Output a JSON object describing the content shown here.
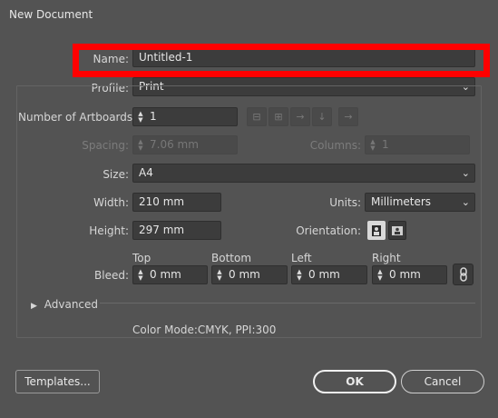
{
  "window": {
    "title": "New Document"
  },
  "name": {
    "label": "Name:",
    "value": "Untitled-1"
  },
  "profile": {
    "label": "Profile:",
    "value": "Print"
  },
  "artboards": {
    "label": "Number of Artboards:",
    "value": "1"
  },
  "spacing": {
    "label": "Spacing:",
    "value": "7.06 mm"
  },
  "columns": {
    "label": "Columns:",
    "value": "1"
  },
  "size": {
    "label": "Size:",
    "value": "A4"
  },
  "width": {
    "label": "Width:",
    "value": "210 mm"
  },
  "units": {
    "label": "Units:",
    "value": "Millimeters"
  },
  "height": {
    "label": "Height:",
    "value": "297 mm"
  },
  "orientation": {
    "label": "Orientation:",
    "selected": "portrait"
  },
  "bleed": {
    "label": "Bleed:",
    "top": {
      "label": "Top",
      "value": "0 mm"
    },
    "bottom": {
      "label": "Bottom",
      "value": "0 mm"
    },
    "left": {
      "label": "Left",
      "value": "0 mm"
    },
    "right": {
      "label": "Right",
      "value": "0 mm"
    }
  },
  "advanced": {
    "label": "Advanced"
  },
  "color_mode_text": "Color Mode:CMYK, PPI:300",
  "buttons": {
    "templates": "Templates...",
    "ok": "OK",
    "cancel": "Cancel"
  },
  "highlight_color": "#ff0000",
  "icons": [
    "chevron-down-icon",
    "stepper-icon",
    "grid-by-row-icon",
    "grid-by-column-icon",
    "arrange-by-row-icon",
    "arrange-by-column-icon",
    "right-to-left-icon",
    "portrait-icon",
    "landscape-icon",
    "link-icon",
    "triangle-right-icon"
  ]
}
